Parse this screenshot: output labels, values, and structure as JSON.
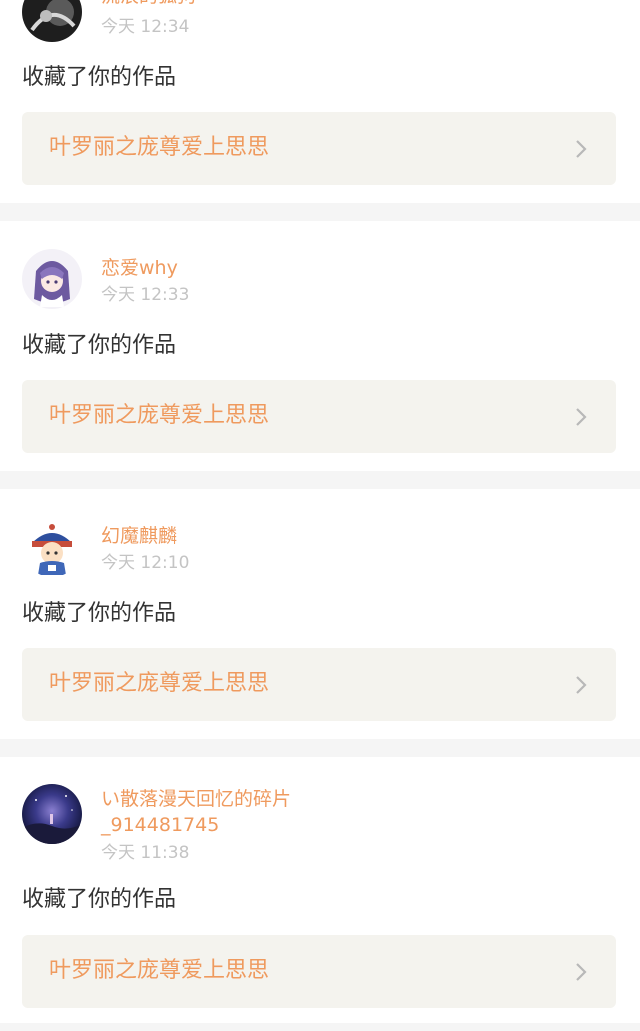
{
  "notifications": [
    {
      "username": "流浪的狐狗",
      "timestamp": "今天 12:34",
      "action": "收藏了你的作品",
      "work_title": "叶罗丽之庞尊爱上思思",
      "avatar_icon": "dark-avatar-icon"
    },
    {
      "username": "恋爱why",
      "timestamp": "今天 12:33",
      "action": "收藏了你的作品",
      "work_title": "叶罗丽之庞尊爱上思思",
      "avatar_icon": "anime-girl-avatar-icon"
    },
    {
      "username": "幻魔麒麟",
      "timestamp": "今天 12:10",
      "action": "收藏了你的作品",
      "work_title": "叶罗丽之庞尊爱上思思",
      "avatar_icon": "qing-official-avatar-icon"
    },
    {
      "username_line1": "い散落漫天回忆的碎片",
      "username_line2": "_914481745",
      "timestamp": "今天 11:38",
      "action": "收藏了你的作品",
      "work_title": "叶罗丽之庞尊爱上思思",
      "avatar_icon": "night-sky-avatar-icon"
    }
  ],
  "colors": {
    "accent": "#ef9a5e",
    "timestamp": "#c4c4c4",
    "link_background": "#f4f3ee",
    "page_background": "#f5f5f5"
  }
}
